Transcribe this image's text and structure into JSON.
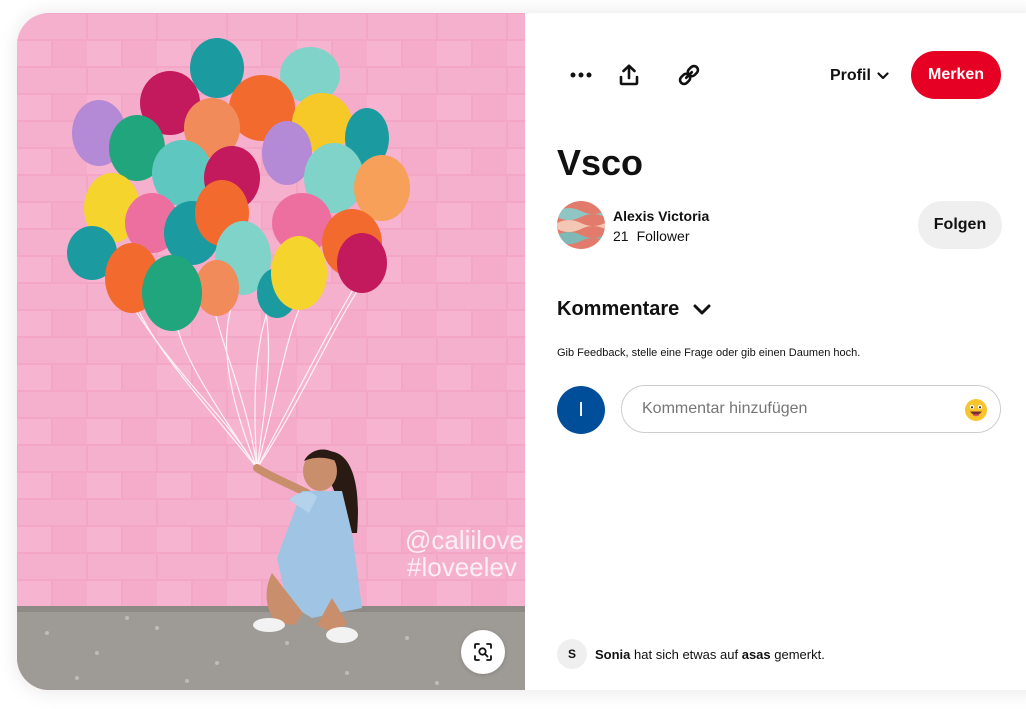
{
  "pin": {
    "title": "Vsco",
    "image_alt": "Girl in blue dress holding painted balloons on a pink brick wall",
    "watermark_line1": "@caliilovee",
    "watermark_line2": "#loveelev"
  },
  "toolbar": {
    "more_icon": "more-horizontal-icon",
    "share_icon": "share-upload-icon",
    "link_icon": "link-icon",
    "profile_label": "Profil",
    "save_label": "Merken"
  },
  "creator": {
    "name": "Alexis Victoria",
    "follower_count": "21",
    "follower_label": "Follower",
    "follow_label": "Folgen"
  },
  "comments": {
    "title": "Kommentare",
    "hint": "Gib Feedback, stelle eine Frage oder gib einen Daumen hoch.",
    "user_initial": "I",
    "placeholder": "Kommentar hinzufügen"
  },
  "activity": {
    "avatar_initial": "S",
    "user": "Sonia",
    "text_middle": "hat sich etwas auf",
    "board": "asas",
    "text_end": "gemerkt."
  },
  "colors": {
    "brand_red": "#e60023",
    "user_avatar_blue": "#004e9a",
    "wall_pink": "#f2a2c4"
  }
}
